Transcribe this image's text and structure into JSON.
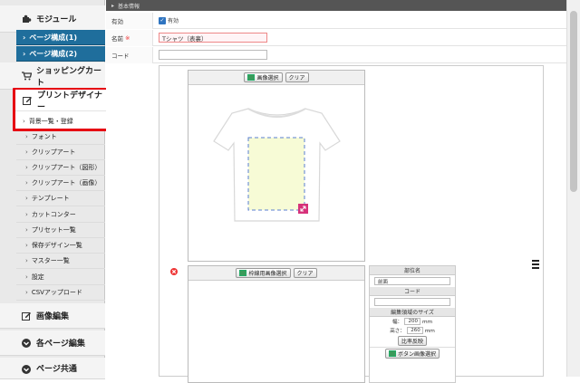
{
  "sidebar": {
    "module_header": "モジュール",
    "page_config_1": "ページ構成(1)",
    "page_config_2": "ページ構成(2)",
    "shopping_cart": "ショッピングカート",
    "print_designer": "プリントデザイナー",
    "items": [
      "背景一覧・登録",
      "フォント",
      "クリップアート",
      "クリップアート（図形）",
      "クリップアート（画像）",
      "テンプレート",
      "カットコンター",
      "プリセット一覧",
      "保存デザイン一覧",
      "マスター一覧",
      "設定",
      "CSVアップロード"
    ],
    "image_edit": "画像編集",
    "each_page_edit": "各ページ編集",
    "page_common": "ページ共通",
    "accent_color": "#1f6e9c",
    "highlight_color": "#e60012"
  },
  "main": {
    "section_title": "基本情報",
    "enabled_label": "有効",
    "enabled_checkbox_label": "有効",
    "name_label": "名前",
    "required_mark": "※",
    "name_value": "Tシャツ（表裏）",
    "code_label": "コード",
    "code_value": ""
  },
  "editor": {
    "top_image_select": "画像選択",
    "top_clear": "クリア",
    "frame_image_select": "枠線用画像選択",
    "frame_clear": "クリア",
    "handle_icon": "menu-handle-icon",
    "part_name_header": "部位名",
    "part_name_value": "前面",
    "code_header": "コード",
    "code_value": "",
    "edit_area_header": "編集領域のサイズ",
    "width_label": "幅：",
    "width_value": "200",
    "height_label": "高さ：",
    "height_value": "260",
    "unit": "ｍｍ",
    "ratio_button": "比率反映",
    "button_image_select": "ボタン画像選択",
    "print_area_color": "#f7fbd6",
    "resize_handle_color": "#d6327a"
  }
}
